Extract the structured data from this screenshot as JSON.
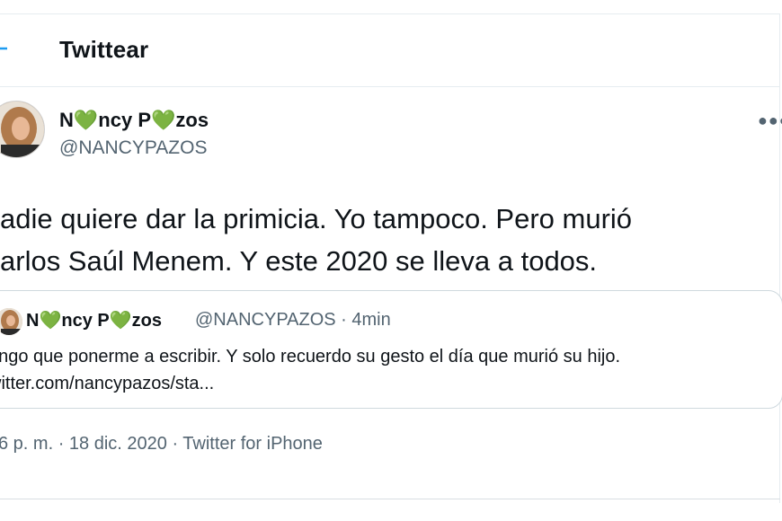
{
  "header": {
    "title": "Twittear"
  },
  "author": {
    "name_parts": [
      "N",
      "ncy P",
      "zos"
    ],
    "heart": "💚",
    "handle": "@NANCYPAZOS"
  },
  "tweet": {
    "lines": [
      "adie quiere dar la primicia. Yo tampoco. Pero murió",
      "arlos Saúl Menem. Y este 2020 se lleva a todos."
    ]
  },
  "quoted": {
    "name_parts": [
      "N",
      "ncy P",
      "zos"
    ],
    "meta": "@NANCYPAZOS · 4min",
    "lines": [
      "engo que ponerme a escribir. Y solo recuerdo su gesto el día que murió su hijo.",
      "witter.com/nancypazos/sta..."
    ]
  },
  "footer": {
    "timestamp": "6 p. m. · 18 dic. 2020 · Twitter for iPhone"
  },
  "icons": {
    "back": "back-arrow-icon",
    "more": "more-options-icon",
    "heart": "green-heart-icon"
  },
  "colors": {
    "text": "#0f1419",
    "secondary": "#536471",
    "accent": "#1d9bf0",
    "heart": "#5cbf3e"
  }
}
